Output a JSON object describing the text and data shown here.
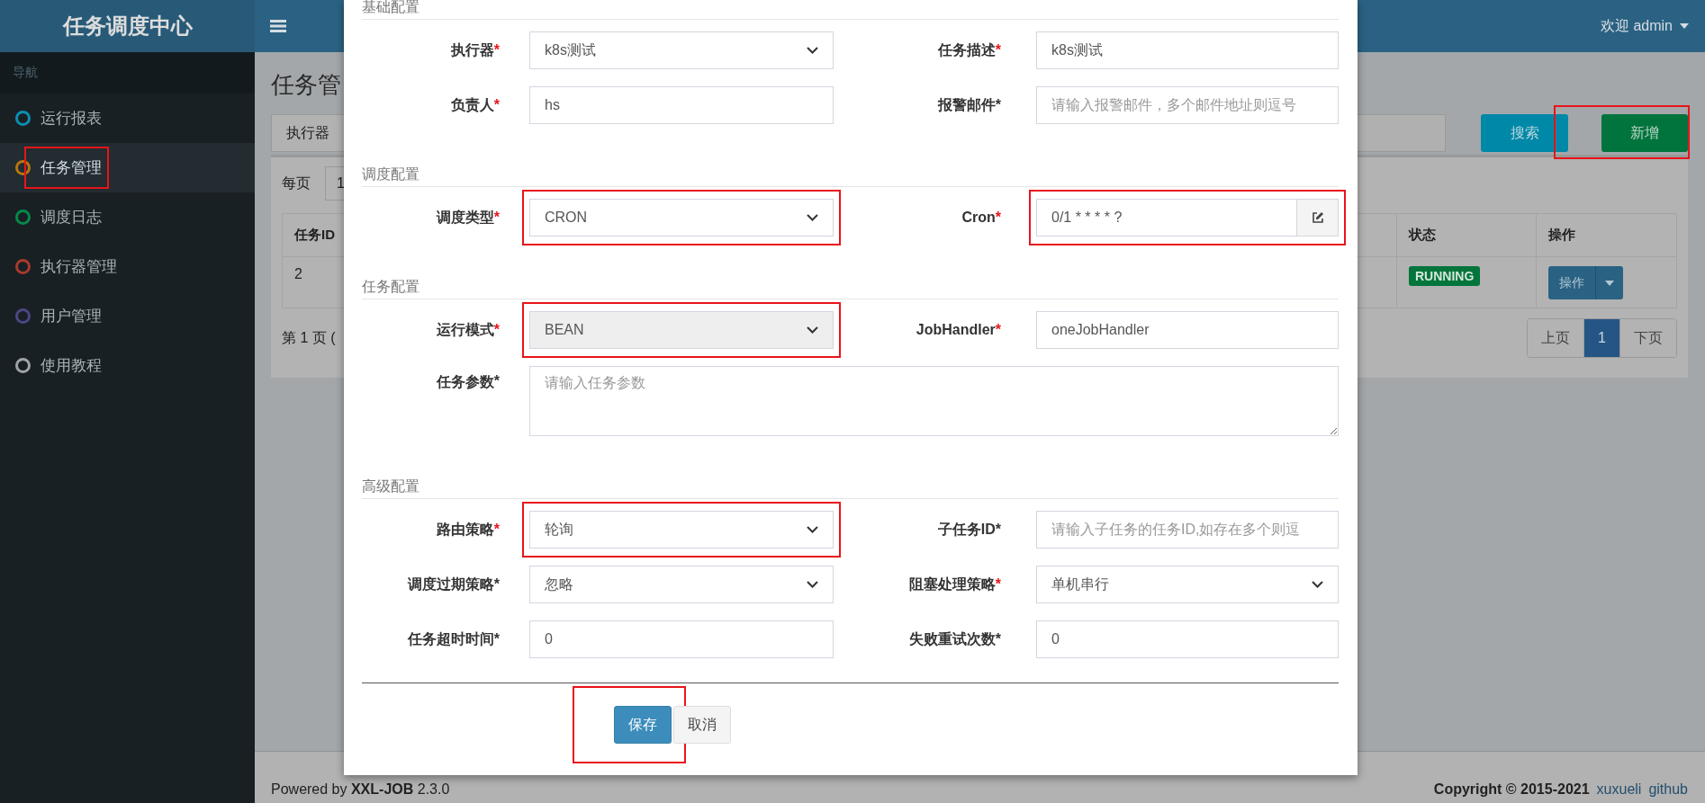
{
  "header": {
    "logo": "任务调度中心",
    "user": "欢迎 admin"
  },
  "sidebar": {
    "heading": "导航",
    "items": [
      {
        "label": "运行报表",
        "color": "#0b8fb0",
        "selected": false,
        "highlighted": false
      },
      {
        "label": "任务管理",
        "color": "#b8770f",
        "selected": true,
        "highlighted": true
      },
      {
        "label": "调度日志",
        "color": "#058a4a",
        "selected": false,
        "highlighted": false
      },
      {
        "label": "执行器管理",
        "color": "#a83a2e",
        "selected": false,
        "highlighted": false
      },
      {
        "label": "用户管理",
        "color": "#4a4785",
        "selected": false,
        "highlighted": false
      },
      {
        "label": "使用教程",
        "color": "#a0a3a8",
        "selected": false,
        "highlighted": false
      }
    ]
  },
  "page": {
    "title": "任务管",
    "filter_label": "执行器",
    "buttons": [
      {
        "label": "搜索",
        "kind": "search",
        "highlighted": false
      },
      {
        "label": "新增",
        "kind": "add",
        "highlighted": true
      }
    ],
    "page_size_label": "每页",
    "page_size_value": "1",
    "table": {
      "columns": [
        "任务ID",
        "状态",
        "操作"
      ],
      "rows": [
        {
          "id": "2",
          "status": "RUNNING",
          "action": "操作"
        }
      ]
    },
    "page_info": "第 1 页 (",
    "pagination": [
      {
        "label": "上页",
        "selected": false
      },
      {
        "label": "1",
        "selected": true
      },
      {
        "label": "下页",
        "selected": false
      }
    ]
  },
  "footer": {
    "powered": "Powered by **XXL-JOB** 2.3.0",
    "copyright": "Copyright © 2015-2021",
    "links": [
      "xuxueli",
      "github"
    ]
  },
  "modal": {
    "sections": [
      {
        "title": "基础配置",
        "fields": [
          {
            "label": "执行器",
            "mark": "*",
            "required": true,
            "kind": "select",
            "value": "k8s测试",
            "disabled": false,
            "highlighted": false
          },
          {
            "label": "任务描述",
            "mark": "*",
            "required": true,
            "kind": "input",
            "value": "k8s测试",
            "disabled": false,
            "highlighted": false
          },
          {
            "label": "负责人",
            "mark": "*",
            "required": true,
            "kind": "input",
            "value": "hs",
            "disabled": false,
            "highlighted": false
          },
          {
            "label": "报警邮件",
            "mark": "*",
            "required": false,
            "kind": "input",
            "placeholder": "请输入报警邮件，多个邮件地址则逗号",
            "disabled": false,
            "highlighted": false
          }
        ]
      },
      {
        "title": "调度配置",
        "fields": [
          {
            "label": "调度类型",
            "mark": "*",
            "required": true,
            "kind": "select",
            "value": "CRON",
            "disabled": false,
            "highlighted": true
          },
          {
            "label": "Cron",
            "mark": "*",
            "required": true,
            "kind": "addon",
            "value": "0/1 * * * * ?",
            "disabled": false,
            "highlighted": true
          }
        ]
      },
      {
        "title": "任务配置",
        "fields": [
          {
            "label": "运行模式",
            "mark": "*",
            "required": true,
            "kind": "select",
            "value": "BEAN",
            "disabled": true,
            "highlighted": true
          },
          {
            "label": "JobHandler",
            "mark": "*",
            "required": true,
            "kind": "input",
            "value": "oneJobHandler",
            "disabled": false,
            "highlighted": false
          },
          {
            "label": "任务参数",
            "mark": "*",
            "required": false,
            "kind": "textarea",
            "placeholder": "请输入任务参数",
            "disabled": false,
            "highlighted": false
          }
        ]
      },
      {
        "title": "高级配置",
        "fields": [
          {
            "label": "路由策略",
            "mark": "*",
            "required": true,
            "kind": "select",
            "value": "轮询",
            "disabled": false,
            "highlighted": true
          },
          {
            "label": "子任务ID",
            "mark": "*",
            "required": false,
            "kind": "input",
            "placeholder": "请输入子任务的任务ID,如存在多个则逗",
            "disabled": false,
            "highlighted": false
          },
          {
            "label": "调度过期策略",
            "mark": "*",
            "required": false,
            "kind": "select",
            "value": "忽略",
            "disabled": false,
            "highlighted": false
          },
          {
            "label": "阻塞处理策略",
            "mark": "*",
            "required": true,
            "kind": "select",
            "value": "单机串行",
            "disabled": false,
            "highlighted": false
          },
          {
            "label": "任务超时时间",
            "mark": "*",
            "required": false,
            "kind": "input",
            "value": "0",
            "disabled": false,
            "highlighted": false
          },
          {
            "label": "失败重试次数",
            "mark": "*",
            "required": false,
            "kind": "input",
            "value": "0",
            "disabled": false,
            "highlighted": false
          }
        ]
      }
    ],
    "buttons": [
      {
        "label": "保存",
        "kind": "primary",
        "highlighted": true
      },
      {
        "label": "取消",
        "kind": "default",
        "highlighted": false
      }
    ]
  }
}
